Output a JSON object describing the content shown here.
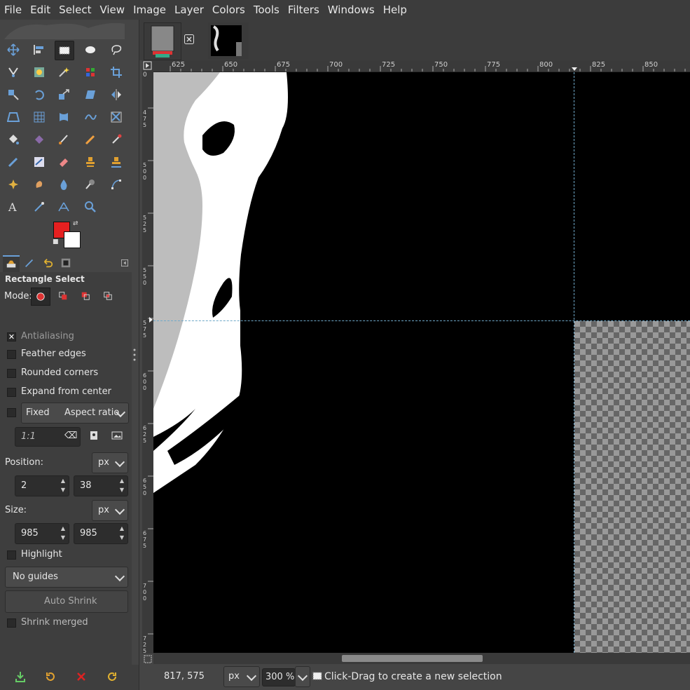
{
  "menubar": [
    "File",
    "Edit",
    "Select",
    "View",
    "Image",
    "Layer",
    "Colors",
    "Tools",
    "Filters",
    "Windows",
    "Help"
  ],
  "tool_options": {
    "title": "Rectangle Select",
    "mode_label": "Mode:",
    "antialiasing": "Antialiasing",
    "feather": "Feather edges",
    "rounded": "Rounded corners",
    "expand": "Expand from center",
    "fixed": "Fixed",
    "fixed_option": "Aspect ratio",
    "ratio": "1:1",
    "position_label": "Position:",
    "size_label": "Size:",
    "unit": "px",
    "pos_x": "2",
    "pos_y": "38",
    "size_w": "985",
    "size_h": "985",
    "highlight": "Highlight",
    "guides": "No guides",
    "auto_shrink": "Auto Shrink",
    "shrink_merged": "Shrink merged"
  },
  "ruler": {
    "top": [
      "625",
      "650",
      "675",
      "700",
      "725",
      "750",
      "775",
      "800",
      "825",
      "850"
    ],
    "left": [
      "0",
      "475",
      "500",
      "525",
      "550",
      "575",
      "600",
      "625",
      "650",
      "675",
      "700",
      "725"
    ]
  },
  "status": {
    "coords": "817, 575",
    "unit": "px",
    "zoom": "300 %",
    "message": "Click-Drag to create a new selection"
  },
  "colors": {
    "foreground": "#e62020",
    "background": "#ffffff",
    "guide": "#6fa8c8"
  }
}
